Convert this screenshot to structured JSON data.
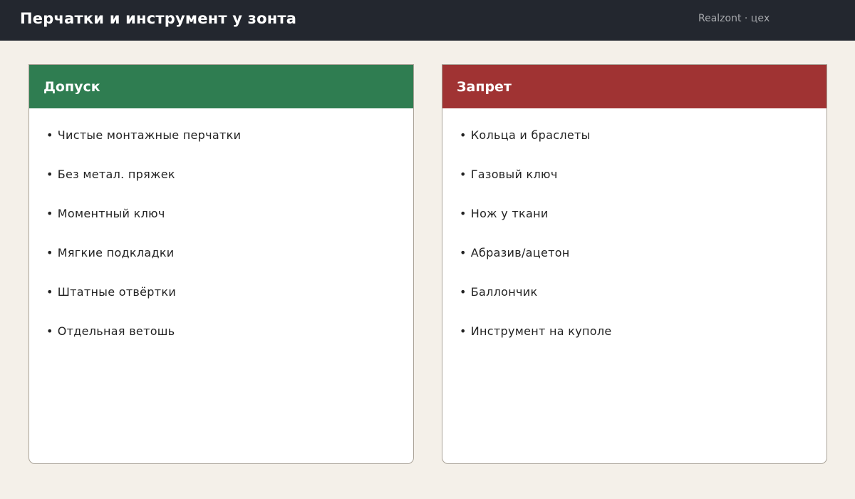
{
  "header": {
    "title": "Перчатки и инструмент у зонта",
    "meta": "Realzont · цех"
  },
  "colors": {
    "header_bg": "#23272f",
    "allow": "#2f7d51",
    "deny": "#a03333",
    "page_bg": "#f4f0e9"
  },
  "allow": {
    "title": "Допуск",
    "items": [
      "Чистые монтажные перчатки",
      "Без метал. пряжек",
      "Моментный ключ",
      "Мягкие подкладки",
      "Штатные отвёртки",
      "Отдельная ветошь"
    ]
  },
  "deny": {
    "title": "Запрет",
    "items": [
      "Кольца и браслеты",
      "Газовый ключ",
      "Нож у ткани",
      "Абразив/ацетон",
      "Баллончик",
      "Инструмент на куполе"
    ]
  }
}
